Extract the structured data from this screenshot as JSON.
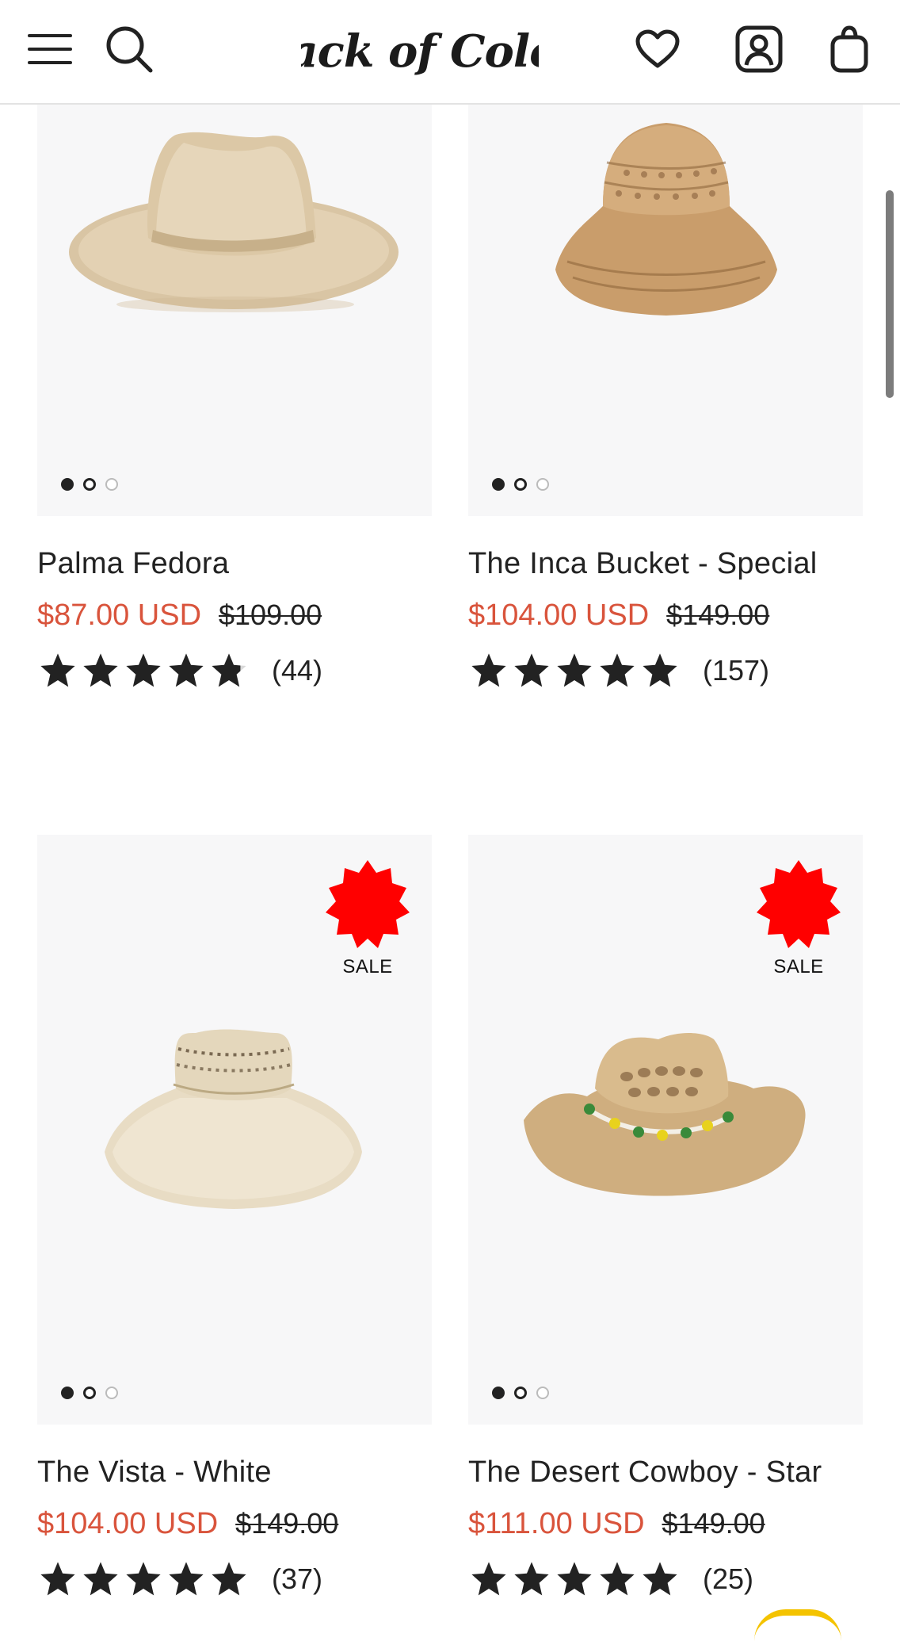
{
  "header": {
    "brand": "Lack of Color",
    "icons": [
      "menu-icon",
      "search-icon",
      "heart-icon",
      "account-icon",
      "bag-icon"
    ]
  },
  "products": [
    {
      "name": "Palma Fedora",
      "price": "$87.00 USD",
      "compare_at": "$109.00",
      "rating": 4.8,
      "reviews": "(44)",
      "sale_badge": false,
      "image_dots": 3,
      "image": "straw-fedora"
    },
    {
      "name": "The Inca Bucket - Special",
      "price": "$104.00 USD",
      "compare_at": "$149.00",
      "rating": 5,
      "reviews": "(157)",
      "sale_badge": false,
      "image_dots": 3,
      "image": "woven-bucket-hat"
    },
    {
      "name": "The Vista - White",
      "price": "$104.00 USD",
      "compare_at": "$149.00",
      "rating": 5,
      "reviews": "(37)",
      "sale_badge": true,
      "sale_label": "SALE",
      "image_dots": 3,
      "image": "wide-brim-straw-hat"
    },
    {
      "name": "The Desert Cowboy - Star",
      "price": "$111.00 USD",
      "compare_at": "$149.00",
      "rating": 5,
      "reviews": "(25)",
      "sale_badge": true,
      "sale_label": "SALE",
      "image_dots": 3,
      "image": "straw-cowboy-hat"
    }
  ],
  "colors": {
    "sale_price": "#d9543c",
    "sale_badge": "#ff0000",
    "text": "#222222",
    "image_bg": "#f7f7f8"
  }
}
